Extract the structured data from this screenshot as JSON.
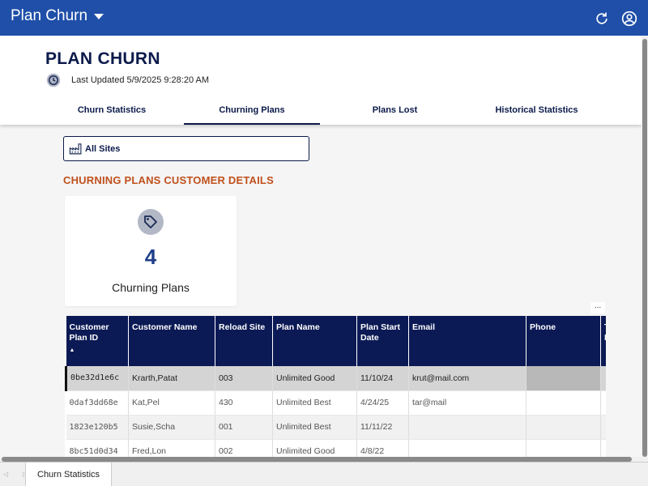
{
  "app": {
    "title": "Plan Churn"
  },
  "header": {
    "title": "PLAN CHURN",
    "last_updated": "Last Updated 5/9/2025 9:28:20 AM"
  },
  "tabs": [
    {
      "label": "Churn Statistics",
      "active": false
    },
    {
      "label": "Churning Plans",
      "active": true
    },
    {
      "label": "Plans Lost",
      "active": false
    },
    {
      "label": "Historical Statistics",
      "active": false
    }
  ],
  "filter": {
    "label": "All Sites"
  },
  "section": {
    "heading": "CHURNING PLANS CUSTOMER DETAILS"
  },
  "kpi": {
    "value": "4",
    "label": "Churning Plans"
  },
  "table": {
    "more_label": "...",
    "sort_indicator": "▲",
    "columns": [
      {
        "label": "Customer Plan ID"
      },
      {
        "label": "Customer Name"
      },
      {
        "label": "Reload Site"
      },
      {
        "label": "Plan Name"
      },
      {
        "label": "Plan Start Date"
      },
      {
        "label": "Email"
      },
      {
        "label": "Phone"
      },
      {
        "label": "T P"
      }
    ],
    "rows": [
      {
        "id": "0be32d1e6c",
        "name": "Krarth,Patat",
        "site": "003",
        "plan": "Unlimited Good",
        "start": "11/10/24",
        "email": "krut@mail.com",
        "phone": "",
        "extra": ""
      },
      {
        "id": "0daf3dd68e",
        "name": "Kat,Pel",
        "site": "430",
        "plan": "Unlimited Best",
        "start": "4/24/25",
        "email": "tar@mail",
        "phone": "",
        "extra": ""
      },
      {
        "id": "1823e120b5",
        "name": "Susie,Scha",
        "site": "001",
        "plan": "Unlimited Best",
        "start": "11/11/22",
        "email": "",
        "phone": "",
        "extra": ""
      },
      {
        "id": "8bc51d0d34",
        "name": "Fred,Lon",
        "site": "002",
        "plan": "Unlimited Good",
        "start": "4/8/22",
        "email": "",
        "phone": "",
        "extra": ""
      }
    ]
  },
  "footer": {
    "sheet_tab": "Churn Statistics",
    "nav": "◁ ▷"
  },
  "colors": {
    "primary": "#1f4fa8",
    "navy": "#0b1a55",
    "accent": "#c0501c"
  },
  "icons": {
    "dropdown": "caret-down-icon",
    "refresh": "refresh-icon",
    "user": "user-circle-icon",
    "clock": "clock-icon",
    "site": "factory-icon",
    "tag": "tag-icon"
  }
}
